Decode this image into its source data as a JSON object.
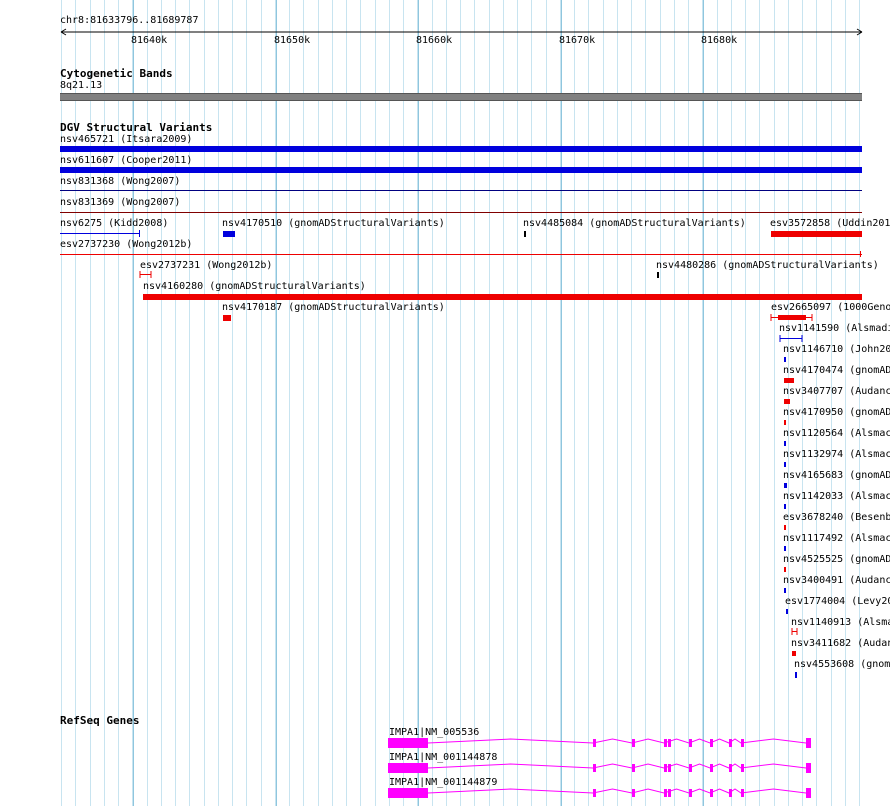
{
  "ruler": {
    "location": "chr8:81633796..81689787",
    "ticks": [
      "81640k",
      "81650k",
      "81660k",
      "81670k",
      "81680k"
    ]
  },
  "tracks": {
    "cytobands": {
      "title": "Cytogenetic Bands",
      "band": "8q21.13"
    },
    "dgv": {
      "title": "DGV Structural Variants",
      "features": [
        {
          "label": "nsv465721 (Itsara2009)",
          "color": "#0000dd"
        },
        {
          "label": "nsv611607 (Cooper2011)",
          "color": "#0000dd"
        },
        {
          "label": "nsv831368 (Wong2007)",
          "color": "#000080"
        },
        {
          "label": "nsv831369 (Wong2007)",
          "color": "#000080"
        },
        {
          "label": "nsv6275 (Kidd2008)",
          "color": "#0000dd"
        },
        {
          "label": "nsv4170510 (gnomADStructuralVariants)",
          "color": "#0000dd"
        },
        {
          "label": "nsv4485084 (gnomADStructuralVariants)",
          "color": "#000000"
        },
        {
          "label": "esv3572858 (Uddin201",
          "color": "#ee0000"
        },
        {
          "label": "esv2737230 (Wong2012b)",
          "color": "#ee0000"
        },
        {
          "label": "esv2737231 (Wong2012b)",
          "color": "#ee0000"
        },
        {
          "label": "nsv4480286 (gnomADStructuralVariants)",
          "color": "#000000"
        },
        {
          "label": "nsv4160280 (gnomADStructuralVariants)",
          "color": "#ee0000"
        },
        {
          "label": "nsv4170187 (gnomADStructuralVariants)",
          "color": "#ee0000"
        },
        {
          "label": "esv2665097 (1000Geno",
          "color": "#ee0000"
        },
        {
          "label": "nsv1141590 (Alsmadi",
          "color": "#0000dd"
        },
        {
          "label": "nsv1146710 (John20",
          "color": "#0000dd"
        },
        {
          "label": "nsv4170474 (gnomAD",
          "color": "#ee0000"
        },
        {
          "label": "nsv3407707 (Audanc",
          "color": "#ee0000"
        },
        {
          "label": "nsv4170950 (gnomAD",
          "color": "#ee0000"
        },
        {
          "label": "nsv1120564 (Alsmac",
          "color": "#0000dd"
        },
        {
          "label": "nsv1132974 (Alsmac",
          "color": "#0000dd"
        },
        {
          "label": "nsv4165683 (gnomAD",
          "color": "#0000dd"
        },
        {
          "label": "nsv1142033 (Alsmac",
          "color": "#0000dd"
        },
        {
          "label": "esv3678240 (Besenb",
          "color": "#ee0000"
        },
        {
          "label": "nsv1117492 (Alsmac",
          "color": "#0000dd"
        },
        {
          "label": "nsv4525525 (gnomAD",
          "color": "#ee0000"
        },
        {
          "label": "nsv3400491 (Audanc",
          "color": "#0000dd"
        },
        {
          "label": "esv1774004 (Levy20",
          "color": "#0000dd"
        },
        {
          "label": "nsv1140913 (Alsma",
          "color": "#ee0000"
        },
        {
          "label": "nsv3411682 (Audan",
          "color": "#ee0000"
        },
        {
          "label": "nsv4553608 (gnom",
          "color": "#0000dd"
        }
      ]
    },
    "refseq": {
      "title": "RefSeq Genes",
      "genes": [
        {
          "label": "IMPA1|NM_005536",
          "color": "#ff00ff"
        },
        {
          "label": "IMPA1|NM_001144878",
          "color": "#ff00ff"
        },
        {
          "label": "IMPA1|NM_001144879",
          "color": "#ff00ff"
        }
      ]
    }
  }
}
